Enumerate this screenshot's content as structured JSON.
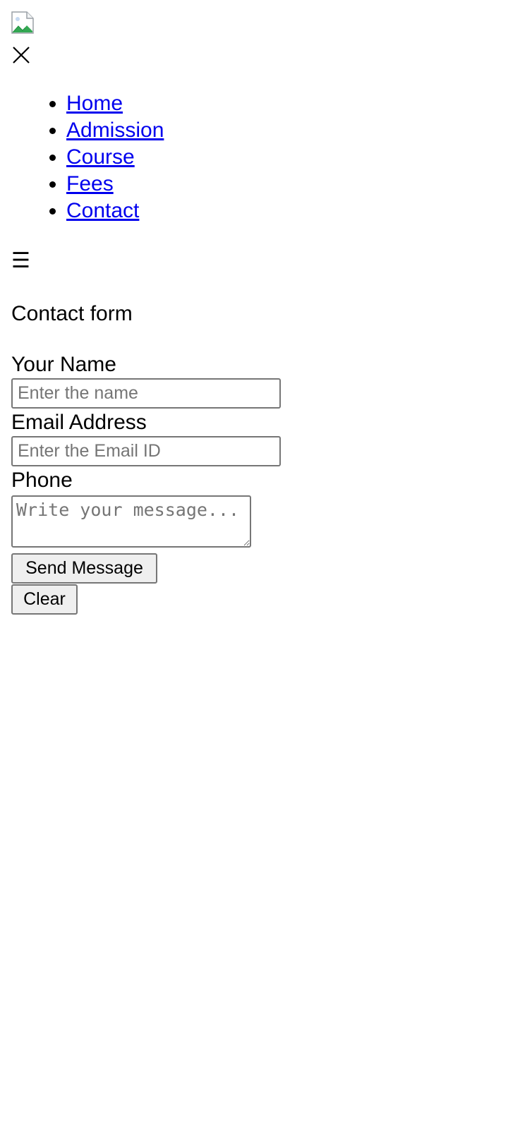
{
  "header": {
    "logo_icon": "broken-image-icon",
    "close_icon": "close-icon"
  },
  "nav": {
    "items": [
      {
        "label": "Home"
      },
      {
        "label": "Admission"
      },
      {
        "label": "Course"
      },
      {
        "label": "Fees"
      },
      {
        "label": "Contact"
      }
    ],
    "menu_toggle": "☰"
  },
  "form": {
    "title": "Contact form",
    "name_label": "Your Name",
    "name_placeholder": "Enter the name",
    "email_label": "Email Address",
    "email_placeholder": "Enter the Email ID",
    "phone_label": "Phone",
    "message_placeholder": "Write your message...",
    "send_label": "Send Message",
    "clear_label": "Clear"
  },
  "colors": {
    "link": "#0000ee",
    "button_bg": "#efefef",
    "border": "#767676"
  }
}
